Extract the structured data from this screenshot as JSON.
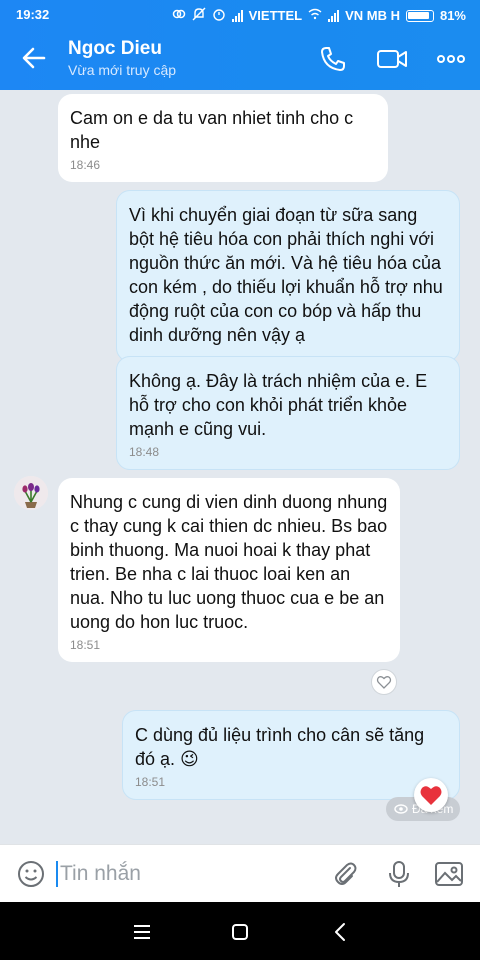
{
  "status_bar": {
    "time": "19:32",
    "carrier1": "VIETTEL",
    "carrier2": "VN MB H",
    "battery": "81%"
  },
  "header": {
    "contact_name": "Ngoc Dieu",
    "contact_status": "Vừa mới truy cập"
  },
  "messages": [
    {
      "direction": "in",
      "text": "Cam on e da tu van nhiet tinh cho c nhe",
      "time": "18:46"
    },
    {
      "direction": "out",
      "text": "Vì khi chuyển giai đoạn từ sữa sang bột hệ tiêu hóa con phải thích nghi với nguồn thức ăn mới. Và hệ tiêu hóa của con kém , do thiếu lợi khuẩn hỗ trợ nhu động ruột của con co bóp và hấp thu dinh dưỡng nên vậy ạ",
      "time": ""
    },
    {
      "direction": "out",
      "text": "Không ạ. Đây là trách nhiệm của e. E hỗ trợ cho con khỏi phát triển khỏe mạnh e cũng vui.",
      "time": "18:48"
    },
    {
      "direction": "in",
      "text": "Nhung c cung di vien dinh duong nhung c thay cung k cai thien dc nhieu. Bs bao binh thuong. Ma nuoi hoai k thay phat trien. Be nha c lai thuoc loai ken an nua. Nho tu luc uong thuoc cua e be an uong do hon luc truoc.",
      "time": "18:51"
    },
    {
      "direction": "out",
      "text": "C dùng đủ liệu trình cho cân sẽ tăng đó ạ. 😉",
      "time": "18:51"
    }
  ],
  "seen_label": "Đã xem",
  "input": {
    "placeholder": "Tin nhắn"
  },
  "colors": {
    "header": "#1a8af0",
    "outgoing_bubble": "#dff1fc",
    "incoming_bubble": "#ffffff",
    "background": "#e3e8ee",
    "heart": "#e8323c"
  }
}
